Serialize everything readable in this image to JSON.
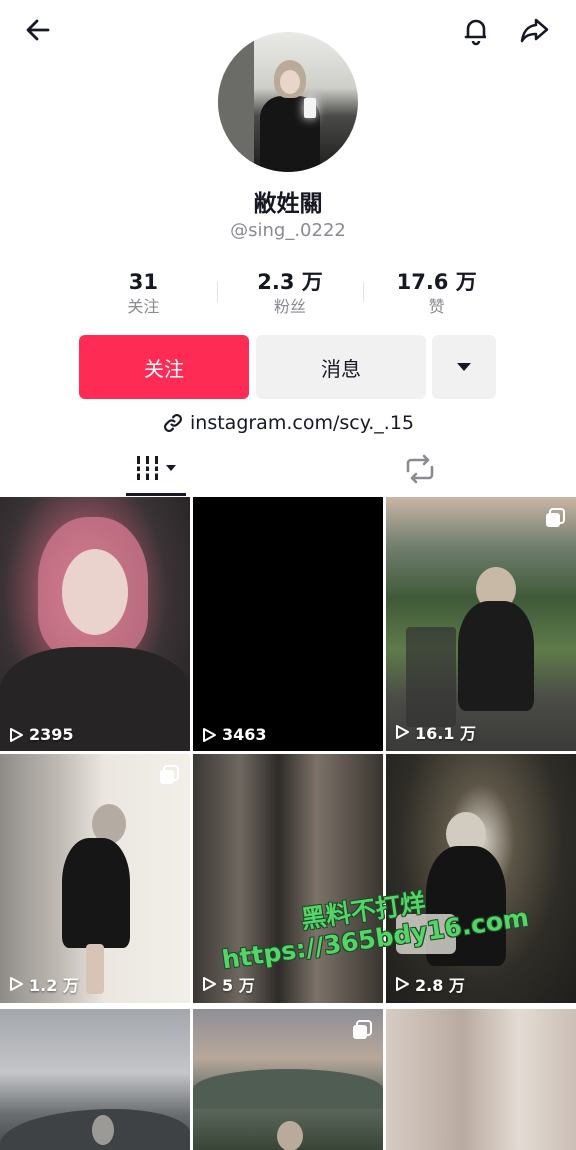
{
  "profile": {
    "name": "敝姓關",
    "handle": "@sing_.0222",
    "link": "instagram.com/scy._.15"
  },
  "stats": [
    {
      "value": "31",
      "label": "关注"
    },
    {
      "value": "2.3 万",
      "label": "粉丝"
    },
    {
      "value": "17.6 万",
      "label": "赞"
    }
  ],
  "actions": {
    "follow_label": "关注",
    "message_label": "消息"
  },
  "icons": {
    "back": "arrow-left-icon",
    "notifications": "bell-icon",
    "share": "share-arrow-icon",
    "link": "link-icon",
    "videos_tab": "grid-bars-icon",
    "reposts_tab": "repost-icon"
  },
  "colors": {
    "accent": "#fe2c55",
    "secondary_button": "#f1f1f2",
    "muted_text": "#8a8b91",
    "watermark": "#55d46a"
  },
  "videos": [
    {
      "views": "2395",
      "multi": false
    },
    {
      "views": "3463",
      "multi": false
    },
    {
      "views": "16.1 万",
      "multi": true
    },
    {
      "views": "1.2 万",
      "multi": true
    },
    {
      "views": "5 万",
      "multi": false
    },
    {
      "views": "2.8 万",
      "multi": false
    },
    {
      "views": "",
      "multi": false
    },
    {
      "views": "",
      "multi": true
    },
    {
      "views": "",
      "multi": false
    }
  ],
  "watermark": {
    "line1": "黑料不打烊",
    "line2": "https://365bdy16.com"
  }
}
